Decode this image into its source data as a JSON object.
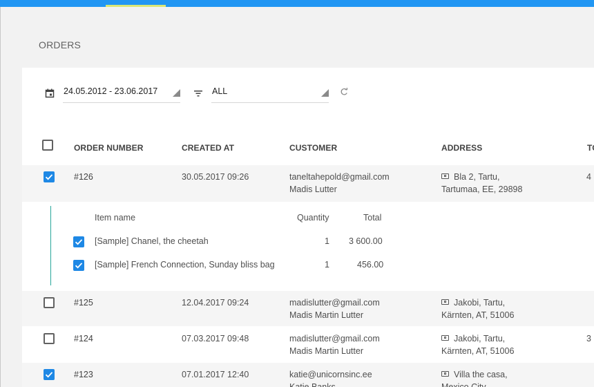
{
  "page": {
    "title": "ORDERS"
  },
  "filters": {
    "date_range": "24.05.2012 - 23.06.2017",
    "status": "ALL"
  },
  "table": {
    "headers": {
      "order_number": "ORDER NUMBER",
      "created_at": "CREATED AT",
      "customer": "CUSTOMER",
      "address": "ADDRESS",
      "total": "TO"
    },
    "rows": [
      {
        "order_number": "#126",
        "created_at": "30.05.2017 09:26",
        "email": "taneltahepold@gmail.com",
        "name": "Madis Lutter",
        "address_line1": "Bla 2, Tartu,",
        "address_line2": "Tartumaa, EE, 29898",
        "total": "4",
        "selected": true
      },
      {
        "order_number": "#125",
        "created_at": "12.04.2017 09:24",
        "email": "madislutter@gmail.com",
        "name": "Madis Martin Lutter",
        "address_line1": "Jakobi, Tartu,",
        "address_line2": "Kärnten, AT, 51006",
        "total": "",
        "selected": false
      },
      {
        "order_number": "#124",
        "created_at": "07.03.2017 09:48",
        "email": "madislutter@gmail.com",
        "name": "Madis Martin Lutter",
        "address_line1": "Jakobi, Tartu,",
        "address_line2": "Kärnten, AT, 51006",
        "total": "3",
        "selected": false
      },
      {
        "order_number": "#123",
        "created_at": "07.01.2017 12:40",
        "email": "katie@unicornsinc.ee",
        "name": "Katie Banks",
        "address_line1": "Villa the casa,",
        "address_line2": "Mexico City",
        "total": "",
        "selected": true
      }
    ]
  },
  "details": {
    "headers": {
      "item_name": "Item name",
      "quantity": "Quantity",
      "total": "Total"
    },
    "items": [
      {
        "name": "[Sample] Chanel, the cheetah",
        "quantity": "1",
        "total": "3 600.00",
        "checked": true
      },
      {
        "name": "[Sample] French Connection, Sunday bliss bag",
        "quantity": "1",
        "total": "456.00",
        "checked": true
      }
    ]
  },
  "icons": {
    "calendar": "calendar-icon",
    "filter": "filter-list-icon",
    "refresh": "refresh-icon",
    "address": "address-card-icon",
    "checkbox": "checkbox-icon"
  },
  "colors": {
    "top_bar": "#2196f3",
    "active_tab_indicator": "#dce775",
    "checkbox_checked": "#1e88e5",
    "detail_accent": "#26a69a"
  }
}
